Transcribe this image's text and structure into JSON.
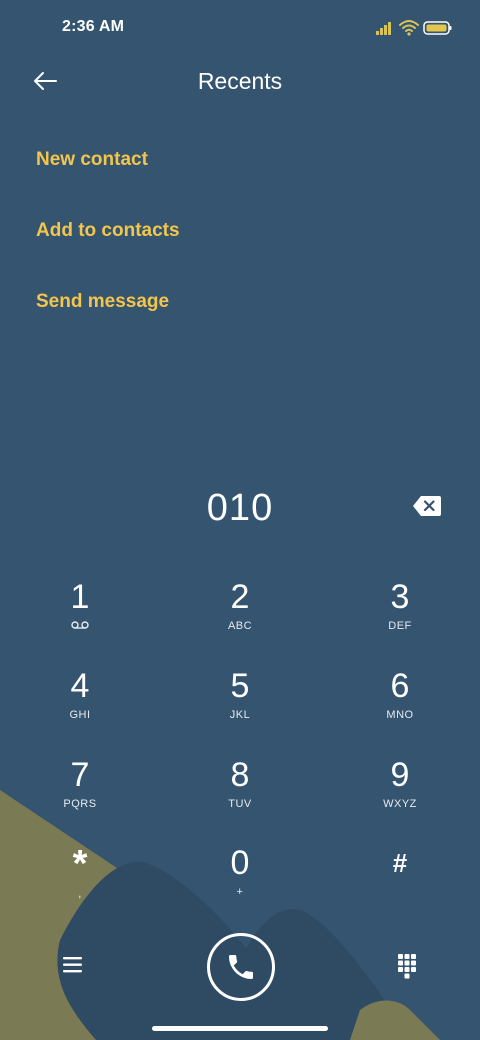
{
  "status_bar": {
    "time": "2:36 AM",
    "icons": [
      "signal-icon",
      "wifi-icon",
      "battery-icon"
    ]
  },
  "header": {
    "title": "Recents",
    "back_icon": "arrow-left-icon"
  },
  "actions": [
    {
      "label": "New contact"
    },
    {
      "label": "Add to contacts"
    },
    {
      "label": "Send message"
    }
  ],
  "dialer": {
    "number": "010",
    "backspace_icon": "backspace-icon"
  },
  "keypad": [
    {
      "digit": "1",
      "sub": "",
      "sub_icon": "voicemail-icon"
    },
    {
      "digit": "2",
      "sub": "ABC"
    },
    {
      "digit": "3",
      "sub": "DEF"
    },
    {
      "digit": "4",
      "sub": "GHI"
    },
    {
      "digit": "5",
      "sub": "JKL"
    },
    {
      "digit": "6",
      "sub": "MNO"
    },
    {
      "digit": "7",
      "sub": "PQRS"
    },
    {
      "digit": "8",
      "sub": "TUV"
    },
    {
      "digit": "9",
      "sub": "WXYZ"
    },
    {
      "digit": "*",
      "sub": ","
    },
    {
      "digit": "0",
      "sub": "+"
    },
    {
      "digit": "#",
      "sub": ""
    }
  ],
  "bottom_bar": {
    "menu_icon": "hamburger-menu-icon",
    "call_icon": "phone-icon",
    "dialpad_icon": "dialpad-icon"
  },
  "colors": {
    "background": "#355470",
    "accent": "#f2c64c",
    "text": "#ffffff",
    "mountain_olive": "#7a7a55",
    "mountain_dark": "#2f4a63"
  }
}
